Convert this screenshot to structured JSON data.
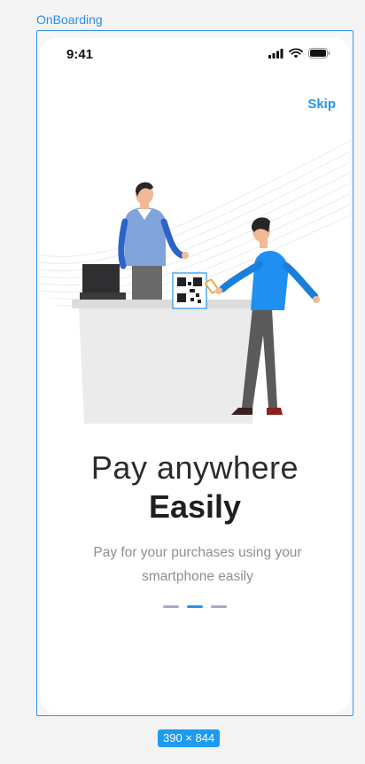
{
  "frame": {
    "label": "OnBoarding",
    "size_badge": "390 × 844"
  },
  "status_bar": {
    "time": "9:41"
  },
  "header": {
    "skip_label": "Skip"
  },
  "content": {
    "title_line1": "Pay anywhere",
    "title_line2": "Easily",
    "subtitle": "Pay for your purchases using  your smartphone easily"
  },
  "pagination": {
    "total": 3,
    "active_index": 1
  },
  "colors": {
    "accent": "#2196f3",
    "frame_border": "#2f94ee",
    "inactive_dot": "#a9a9c4"
  }
}
